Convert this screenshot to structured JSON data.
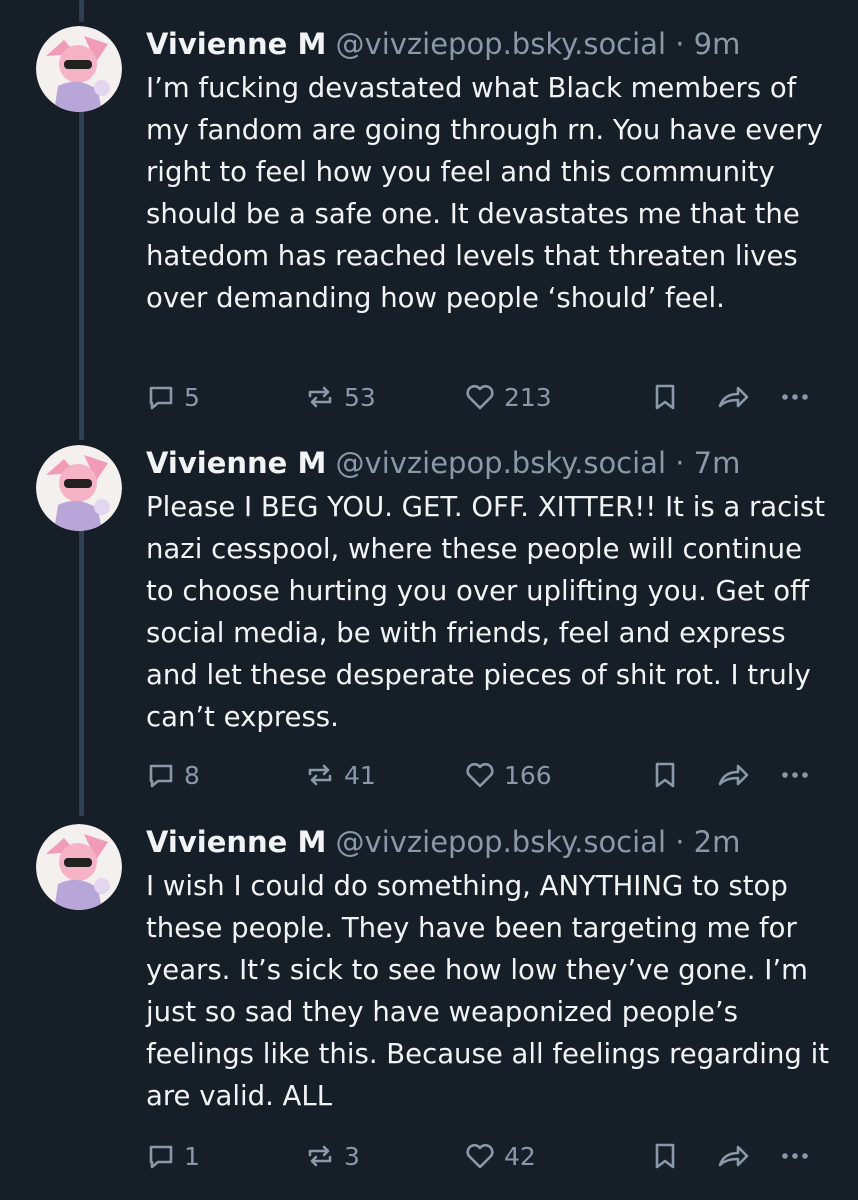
{
  "posts": [
    {
      "author": "Vivienne M",
      "handle": "@vivziepop.bsky.social",
      "separator": "·",
      "time": "9m",
      "text": "I’m fucking devastated what Black members of my fandom are going through rn. You have every right to feel how you feel and this community should be a safe one. It devastates me that the hatedom has reached levels that threaten lives over demanding how people ‘should’ feel.",
      "replies": "5",
      "reposts": "53",
      "likes": "213"
    },
    {
      "author": "Vivienne M",
      "handle": "@vivziepop.bsky.social",
      "separator": "·",
      "time": "7m",
      "text": "Please I BEG YOU. GET. OFF. XITTER!! It is a racist nazi cesspool, where these people will continue to choose hurting you over uplifting you. Get off social media, be with friends, feel and express and let these desperate pieces of shit rot. I truly can’t express.",
      "replies": "8",
      "reposts": "41",
      "likes": "166"
    },
    {
      "author": "Vivienne M",
      "handle": "@vivziepop.bsky.social",
      "separator": "·",
      "time": "2m",
      "text": "I wish I could do something, ANYTHING to stop these people. They have been targeting me for years. It’s sick to see how low they’ve gone. I’m just so sad they have weaponized people’s feelings like this. Because all feelings regarding it are valid. ALL",
      "replies": "1",
      "reposts": "3",
      "likes": "42"
    }
  ],
  "colors": {
    "background": "#161e27",
    "text": "#f1f3f5",
    "muted": "#8b98a7",
    "thread_line": "#2e4052"
  },
  "icons": [
    "reply-icon",
    "repost-icon",
    "like-icon",
    "bookmark-icon",
    "share-icon",
    "more-icon"
  ]
}
